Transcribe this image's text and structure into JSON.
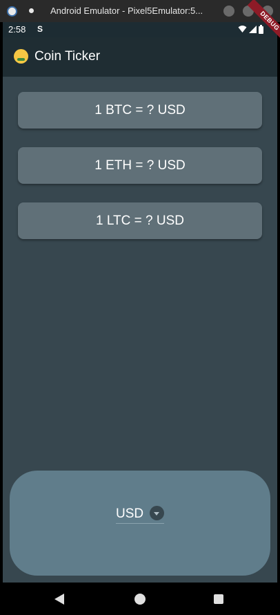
{
  "emulator": {
    "title": "Android Emulator - Pixel5Emulator:5..."
  },
  "status_bar": {
    "time": "2:58",
    "notification_glyph": "S"
  },
  "app_bar": {
    "emoji_icon": "money-mouth-face-icon",
    "title": "Coin Ticker",
    "debug_banner": "DEBUG"
  },
  "rates": [
    {
      "label": "1 BTC = ? USD"
    },
    {
      "label": "1 ETH = ? USD"
    },
    {
      "label": "1 LTC = ? USD"
    }
  ],
  "currency_picker": {
    "selected": "USD"
  },
  "nav_bar": {
    "buttons": [
      "back",
      "home",
      "recents"
    ]
  },
  "colors": {
    "app_bar": "#1f2d33",
    "background": "#37474f",
    "card": "#607078",
    "picker_panel": "#607d8b",
    "debug": "#8e1b27"
  }
}
